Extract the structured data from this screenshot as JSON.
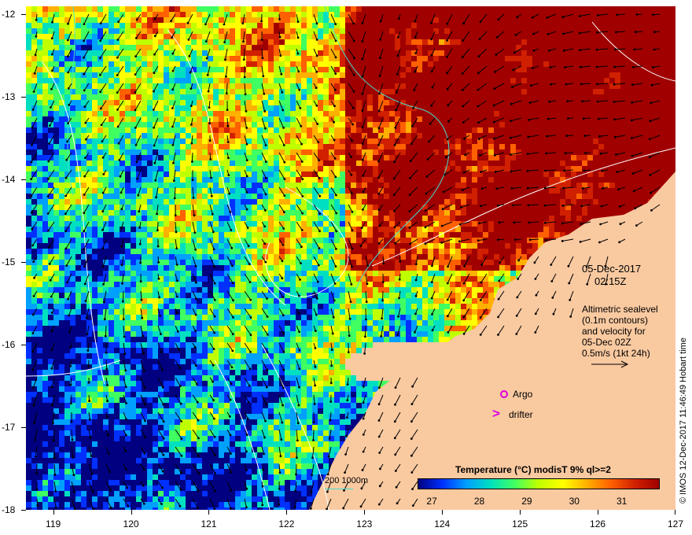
{
  "map": {
    "x_ticks": [
      "119",
      "120",
      "121",
      "122",
      "123",
      "124",
      "125",
      "126",
      "127"
    ],
    "y_ticks": [
      "-12",
      "-13",
      "-14",
      "-15",
      "-16",
      "-17",
      "-18"
    ],
    "lon_range": [
      118.65,
      127.0
    ],
    "lat_range": [
      -11.9,
      -18.0
    ]
  },
  "annotation": {
    "date": "05-Dec-2017",
    "time": "02:15Z",
    "altimetry_lines": [
      "Altimetric sealevel",
      "(0.1m contours)",
      "and velocity for",
      "05-Dec 02Z",
      "0.5m/s (1kt 24h)"
    ]
  },
  "markers": {
    "argo_label": "Argo",
    "drifter_label": "drifter"
  },
  "depth_legend": {
    "label": "200  1000m"
  },
  "colorbar": {
    "title": "Temperature (°C) modisT 9% ql>=2",
    "ticks": [
      "27",
      "28",
      "29",
      "30",
      "31"
    ],
    "range": [
      26.7,
      31.8
    ],
    "colors": [
      "#000080",
      "#0030ff",
      "#00a0ff",
      "#00e0c0",
      "#40ff60",
      "#c0ff00",
      "#ffff00",
      "#ffb000",
      "#ff6000",
      "#d02000",
      "#a00000"
    ]
  },
  "credit": "© IMOS 12-Dec-2017 11:46:49 Hobart time",
  "colors": {
    "land": "#f9c9a0",
    "contour": "#ffffff",
    "isobath": "#40e0d0",
    "marker": "#e000e0"
  }
}
